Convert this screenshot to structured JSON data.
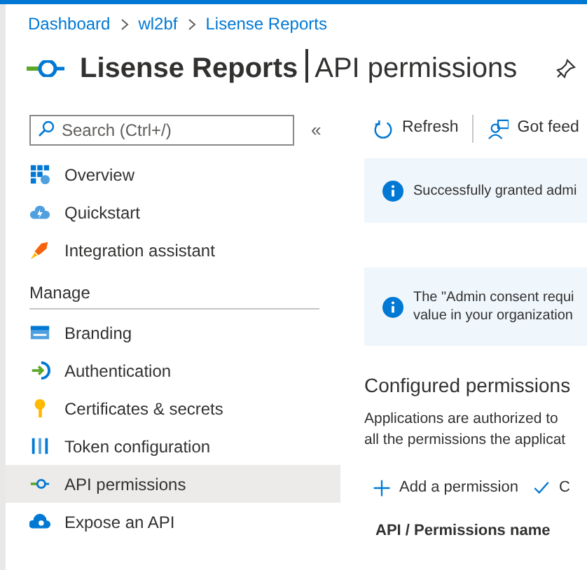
{
  "breadcrumb": [
    "Dashboard",
    "wl2bf",
    "Lisense Reports"
  ],
  "title": {
    "main": "Lisense Reports",
    "section": "API permissions"
  },
  "sidebar": {
    "search": {
      "placeholder": "Search (Ctrl+/)"
    },
    "collapse": "«",
    "items": [
      {
        "label": "Overview",
        "selected": false
      },
      {
        "label": "Quickstart",
        "selected": false
      },
      {
        "label": "Integration assistant",
        "selected": false
      }
    ],
    "group": "Manage",
    "manage_items": [
      {
        "label": "Branding",
        "selected": false
      },
      {
        "label": "Authentication",
        "selected": false
      },
      {
        "label": "Certificates & secrets",
        "selected": false
      },
      {
        "label": "Token configuration",
        "selected": false
      },
      {
        "label": "API permissions",
        "selected": true
      },
      {
        "label": "Expose an API",
        "selected": false
      }
    ]
  },
  "toolbar": [
    {
      "label": "Refresh"
    },
    {
      "label": "Got feed"
    }
  ],
  "notices": [
    {
      "lines": [
        "Successfully granted admi"
      ]
    },
    {
      "lines": [
        "The \"Admin consent requi",
        "value in your organization"
      ]
    }
  ],
  "section": {
    "title": "Configured permissions",
    "text": [
      "Applications are authorized to",
      "all the permissions the applicat"
    ],
    "actions": [
      {
        "label": "Add a permission"
      },
      {
        "label": "C"
      }
    ],
    "column": "API / Permissions name"
  }
}
